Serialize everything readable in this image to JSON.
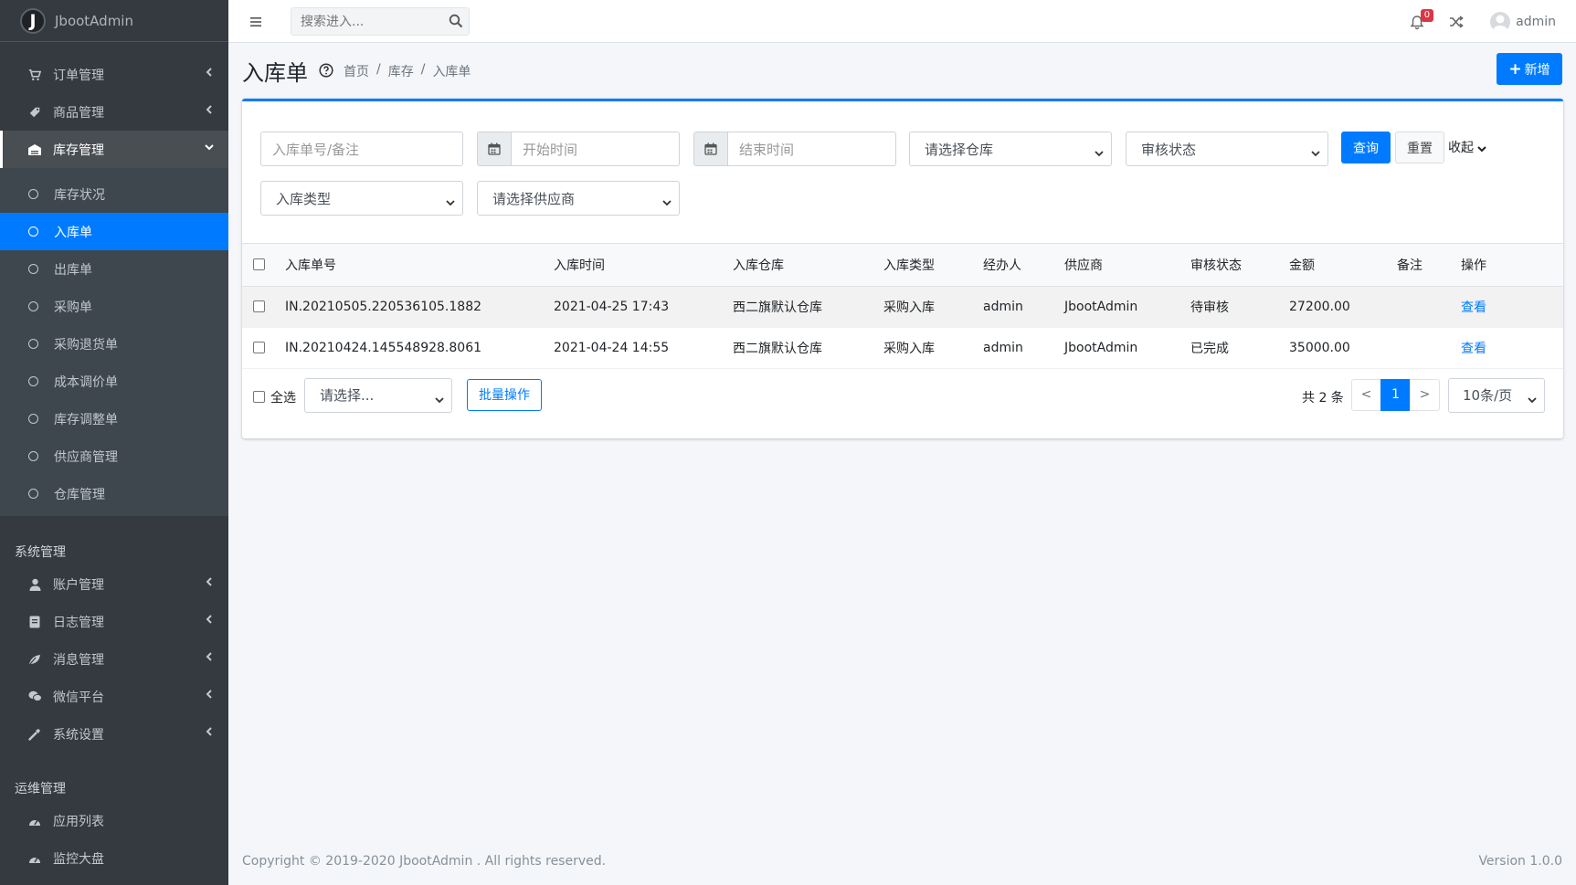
{
  "brand": {
    "name": "JbootAdmin",
    "logo_letter": "J"
  },
  "sidebar": {
    "groups": [
      {
        "label": "订单管理",
        "icon": "cart-icon"
      },
      {
        "label": "商品管理",
        "icon": "tag-icon"
      },
      {
        "label": "库存管理",
        "icon": "warehouse-icon"
      }
    ],
    "stock_sub": [
      "库存状况",
      "入库单",
      "出库单",
      "采购单",
      "采购退货单",
      "成本调价单",
      "库存调整单",
      "供应商管理",
      "仓库管理"
    ],
    "system_header": "系统管理",
    "system_items": [
      {
        "label": "账户管理",
        "icon": "user-icon"
      },
      {
        "label": "日志管理",
        "icon": "log-icon"
      },
      {
        "label": "消息管理",
        "icon": "message-icon"
      },
      {
        "label": "微信平台",
        "icon": "wechat-icon"
      },
      {
        "label": "系统设置",
        "icon": "wrench-icon"
      }
    ],
    "ops_header": "运维管理",
    "ops_items": [
      {
        "label": "应用列表",
        "icon": "dashboard-icon"
      },
      {
        "label": "监控大盘",
        "icon": "dashboard-icon"
      }
    ]
  },
  "topbar": {
    "search_placeholder": "搜索进入...",
    "notification_count": "0",
    "username": "admin"
  },
  "header": {
    "title": "入库单",
    "breadcrumb": [
      "首页",
      "库存",
      "入库单"
    ],
    "add_label": "新增",
    "add_plus": "+"
  },
  "filters": {
    "keyword_placeholder": "入库单号/备注",
    "start_placeholder": "开始时间",
    "end_placeholder": "结束时间",
    "warehouse": "请选择仓库",
    "audit": "审核状态",
    "type": "入库类型",
    "supplier": "请选择供应商",
    "query": "查询",
    "reset": "重置",
    "collapse": "收起"
  },
  "table": {
    "headers": [
      "入库单号",
      "入库时间",
      "入库仓库",
      "入库类型",
      "经办人",
      "供应商",
      "审核状态",
      "金额",
      "备注",
      "操作"
    ],
    "rows": [
      {
        "no": "IN.20210505.220536105.1882",
        "time": "2021-04-25 17:43",
        "warehouse": "西二旗默认仓库",
        "type": "采购入库",
        "handler": "admin",
        "supplier": "JbootAdmin",
        "status": "待审核",
        "amount": "27200.00",
        "remark": "",
        "action": "查看"
      },
      {
        "no": "IN.20210424.145548928.8061",
        "time": "2021-04-24 14:55",
        "warehouse": "西二旗默认仓库",
        "type": "采购入库",
        "handler": "admin",
        "supplier": "JbootAdmin",
        "status": "已完成",
        "amount": "35000.00",
        "remark": "",
        "action": "查看"
      }
    ]
  },
  "footer_bar": {
    "select_all": "全选",
    "bulk_select": "请选择...",
    "bulk_btn": "批量操作",
    "total": "共 2 条",
    "prev": "<",
    "page": "1",
    "next": ">",
    "pagesize": "10条/页"
  },
  "footer": {
    "copyright": "Copyright © 2019-2020 JbootAdmin . All rights reserved.",
    "version": "Version 1.0.0"
  },
  "colors": {
    "primary": "#007bff",
    "sidebar_bg": "#343a40",
    "badge": "#dc3545"
  }
}
